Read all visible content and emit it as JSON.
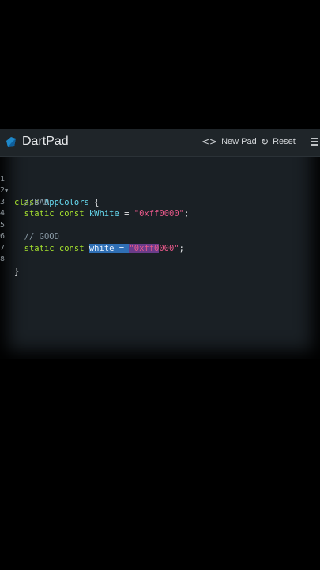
{
  "app": {
    "title": "DartPad",
    "new_pad_label": "New Pad",
    "reset_label": "Reset",
    "new_pad_icon": "code-icon",
    "reset_icon": "refresh-icon",
    "logo_icon": "dart-logo-icon",
    "accent": "#1e88c9"
  },
  "editor": {
    "lines": [
      {
        "num": "1",
        "text": "class AppColors {"
      },
      {
        "num": "2",
        "text": "//BAD"
      },
      {
        "num": "3",
        "text": "static const kWhite = \"0xff0000\";"
      },
      {
        "num": "4",
        "text": ""
      },
      {
        "num": "5",
        "text": "// GOOD"
      },
      {
        "num": "6",
        "text": "static const white = \"0xff0000\";"
      },
      {
        "num": "7",
        "text": ""
      },
      {
        "num": "8",
        "text": "}"
      }
    ],
    "tokens": {
      "class_kw": "class",
      "class_name": "AppColors",
      "open_brace": "{",
      "comment_bad": "//BAD",
      "static_const": "static const",
      "bad_name": "kWhite",
      "eq": "=",
      "bad_value": "\"0xff0000\"",
      "semi": ";",
      "comment_good": "// GOOD",
      "good_sel": "white = ",
      "good_val_sel": "\"0xff0",
      "good_val_rest": "000\"",
      "close_brace": "}"
    }
  }
}
